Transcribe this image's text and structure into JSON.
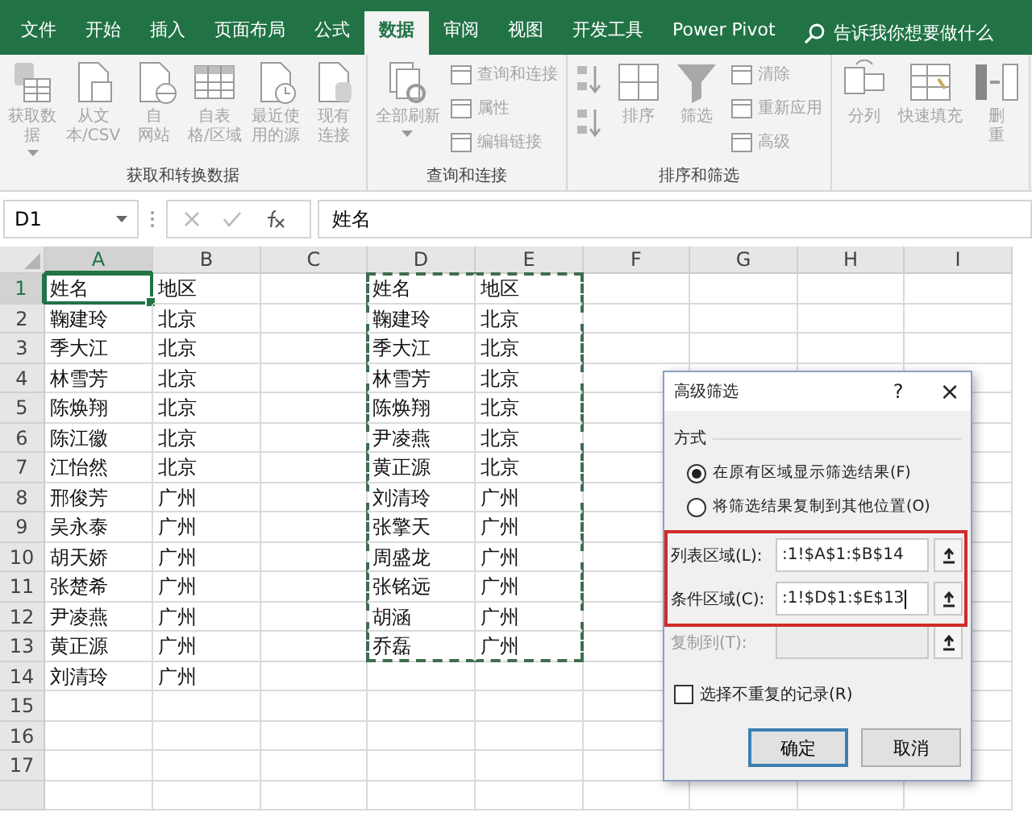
{
  "tabs": [
    {
      "label": "文件",
      "selected": false
    },
    {
      "label": "开始",
      "selected": false
    },
    {
      "label": "插入",
      "selected": false
    },
    {
      "label": "页面布局",
      "selected": false
    },
    {
      "label": "公式",
      "selected": false
    },
    {
      "label": "数据",
      "selected": true
    },
    {
      "label": "审阅",
      "selected": false
    },
    {
      "label": "视图",
      "selected": false
    },
    {
      "label": "开发工具",
      "selected": false
    },
    {
      "label": "Power Pivot",
      "selected": false
    }
  ],
  "tell_me": {
    "label": "告诉我你想要做什么"
  },
  "ribbon": {
    "groups": [
      {
        "label": "获取和转换数据",
        "items": [
          {
            "kind": "large",
            "lines": [
              "获取数",
              "据"
            ],
            "dropdown": true,
            "disabled": true
          },
          {
            "kind": "large",
            "lines": [
              "从文",
              "本/CSV"
            ],
            "dropdown": false,
            "disabled": true
          },
          {
            "kind": "large",
            "lines": [
              "自",
              "网站"
            ],
            "dropdown": false,
            "disabled": true
          },
          {
            "kind": "large",
            "lines": [
              "自表",
              "格/区域"
            ],
            "dropdown": false,
            "disabled": true
          },
          {
            "kind": "large",
            "lines": [
              "最近使",
              "用的源"
            ],
            "dropdown": false,
            "disabled": true
          },
          {
            "kind": "large",
            "lines": [
              "现有",
              "连接"
            ],
            "dropdown": false,
            "disabled": true
          }
        ]
      },
      {
        "label": "查询和连接",
        "items": [
          {
            "kind": "large",
            "lines": [
              "全部刷新"
            ],
            "dropdown": true,
            "disabled": true
          },
          {
            "kind": "stack",
            "buttons": [
              {
                "label": "查询和连接",
                "disabled": true
              },
              {
                "label": "属性",
                "disabled": true
              },
              {
                "label": "编辑链接",
                "disabled": true
              }
            ]
          }
        ]
      },
      {
        "label": "排序和筛选",
        "items": [
          {
            "kind": "sort_stack",
            "buttons": [
              {
                "disabled": true
              },
              {
                "disabled": true
              }
            ]
          },
          {
            "kind": "large",
            "lines": [
              "排序"
            ],
            "dropdown": false,
            "disabled": true
          },
          {
            "kind": "large",
            "lines": [
              "筛选"
            ],
            "dropdown": false,
            "disabled": true
          },
          {
            "kind": "stack",
            "buttons": [
              {
                "label": "清除",
                "disabled": true
              },
              {
                "label": "重新应用",
                "disabled": true
              },
              {
                "label": "高级",
                "disabled": true
              }
            ]
          }
        ]
      },
      {
        "items": [
          {
            "kind": "large",
            "lines": [
              "分列"
            ],
            "dropdown": false,
            "disabled": true
          },
          {
            "kind": "large",
            "lines": [
              "快速填充"
            ],
            "dropdown": false,
            "disabled": true
          },
          {
            "kind": "large",
            "lines": [
              "删",
              "重"
            ],
            "dropdown": false,
            "disabled": true
          }
        ]
      }
    ]
  },
  "formula_bar": {
    "name_box": "D1",
    "formula": "姓名"
  },
  "sheet": {
    "columns": [
      {
        "label": "A",
        "selected": true,
        "marquee": false
      },
      {
        "label": "B",
        "selected": false,
        "marquee": false
      },
      {
        "label": "C",
        "selected": false,
        "marquee": false
      },
      {
        "label": "D",
        "selected": false,
        "marquee": true
      },
      {
        "label": "E",
        "selected": false,
        "marquee": true
      },
      {
        "label": "F",
        "selected": false,
        "marquee": false
      },
      {
        "label": "G",
        "selected": false,
        "marquee": false
      },
      {
        "label": "H",
        "selected": false,
        "marquee": false
      },
      {
        "label": "I",
        "selected": false,
        "marquee": false
      }
    ],
    "rows": [
      {
        "label": "1",
        "selected": true,
        "marquee": true,
        "cells": [
          "姓名",
          "地区",
          null,
          "姓名",
          "地区"
        ]
      },
      {
        "label": "2",
        "selected": false,
        "marquee": true,
        "cells": [
          "鞠建玲",
          "北京",
          null,
          "鞠建玲",
          "北京"
        ]
      },
      {
        "label": "3",
        "selected": false,
        "marquee": true,
        "cells": [
          "季大江",
          "北京",
          null,
          "季大江",
          "北京"
        ]
      },
      {
        "label": "4",
        "selected": false,
        "marquee": true,
        "cells": [
          "林雪芳",
          "北京",
          null,
          "林雪芳",
          "北京"
        ]
      },
      {
        "label": "5",
        "selected": false,
        "marquee": true,
        "cells": [
          "陈焕翔",
          "北京",
          null,
          "陈焕翔",
          "北京"
        ]
      },
      {
        "label": "6",
        "selected": false,
        "marquee": true,
        "cells": [
          "陈江徽",
          "北京",
          null,
          "尹凌燕",
          "北京"
        ]
      },
      {
        "label": "7",
        "selected": false,
        "marquee": true,
        "cells": [
          "江怡然",
          "北京",
          null,
          "黄正源",
          "北京"
        ]
      },
      {
        "label": "8",
        "selected": false,
        "marquee": true,
        "cells": [
          "邢俊芳",
          "广州",
          null,
          "刘清玲",
          "广州"
        ]
      },
      {
        "label": "9",
        "selected": false,
        "marquee": true,
        "cells": [
          "吴永泰",
          "广州",
          null,
          "张擎天",
          "广州"
        ]
      },
      {
        "label": "10",
        "selected": false,
        "marquee": true,
        "cells": [
          "胡天娇",
          "广州",
          null,
          "周盛龙",
          "广州"
        ]
      },
      {
        "label": "11",
        "selected": false,
        "marquee": true,
        "cells": [
          "张楚希",
          "广州",
          null,
          "张铭远",
          "广州"
        ]
      },
      {
        "label": "12",
        "selected": false,
        "marquee": true,
        "cells": [
          "尹凌燕",
          "广州",
          null,
          "胡涵",
          "广州"
        ]
      },
      {
        "label": "13",
        "selected": false,
        "marquee": true,
        "cells": [
          "黄正源",
          "广州",
          null,
          "乔磊",
          "广州"
        ]
      },
      {
        "label": "14",
        "selected": false,
        "marquee": false,
        "cells": [
          "刘清玲",
          "广州"
        ]
      },
      {
        "label": "15",
        "selected": false,
        "marquee": false,
        "cells": []
      },
      {
        "label": "16",
        "selected": false,
        "marquee": false,
        "cells": []
      },
      {
        "label": "17",
        "selected": false,
        "marquee": false,
        "cells": []
      },
      {
        "selected": false,
        "marquee": false,
        "cells": []
      }
    ]
  },
  "dialog": {
    "title": "高级筛选",
    "help": "?",
    "close": "×",
    "section": "方式",
    "options": [
      {
        "label": "在原有区域显示筛选结果(F)",
        "selected": true
      },
      {
        "label": "将筛选结果复制到其他位置(O)",
        "selected": false
      }
    ],
    "fields": [
      {
        "label": "列表区域(L):",
        "value": ":1!$A$1:$B$14",
        "disabled": false,
        "highlighted": true
      },
      {
        "label": "条件区域(C):",
        "value": ":1!$D$1:$E$13",
        "disabled": false,
        "highlighted": true
      },
      {
        "label": "复制到(T):",
        "disabled": true,
        "highlighted": false
      }
    ],
    "unique": {
      "label": "选择不重复的记录(R)",
      "checked": false
    },
    "buttons": [
      {
        "label": "确定",
        "default": true
      },
      {
        "label": "取消",
        "default": false
      }
    ]
  }
}
